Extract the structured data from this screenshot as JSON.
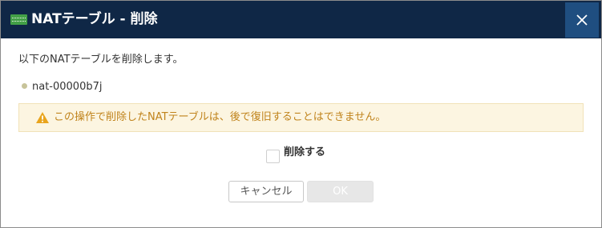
{
  "dialog": {
    "title": "NATテーブル - 削除",
    "title_icon": "nat-table-icon",
    "close_icon": "close-icon"
  },
  "body": {
    "message": "以下のNATテーブルを削除します。",
    "items": [
      "nat-00000b7j"
    ],
    "warning": {
      "icon": "warning-triangle-icon",
      "text": "この操作で削除したNATテーブルは、後で復旧することはできません。"
    },
    "confirm": {
      "label": "削除する",
      "checked": false
    }
  },
  "buttons": {
    "cancel": "キャンセル",
    "ok": "OK"
  },
  "colors": {
    "titlebar": "#0f2746",
    "close_button": "#1f4e80",
    "icon_green": "#43a047",
    "warning_bg": "#fcf5e1",
    "warning_text": "#c0831b",
    "ok_disabled": "#e7e7e7"
  }
}
